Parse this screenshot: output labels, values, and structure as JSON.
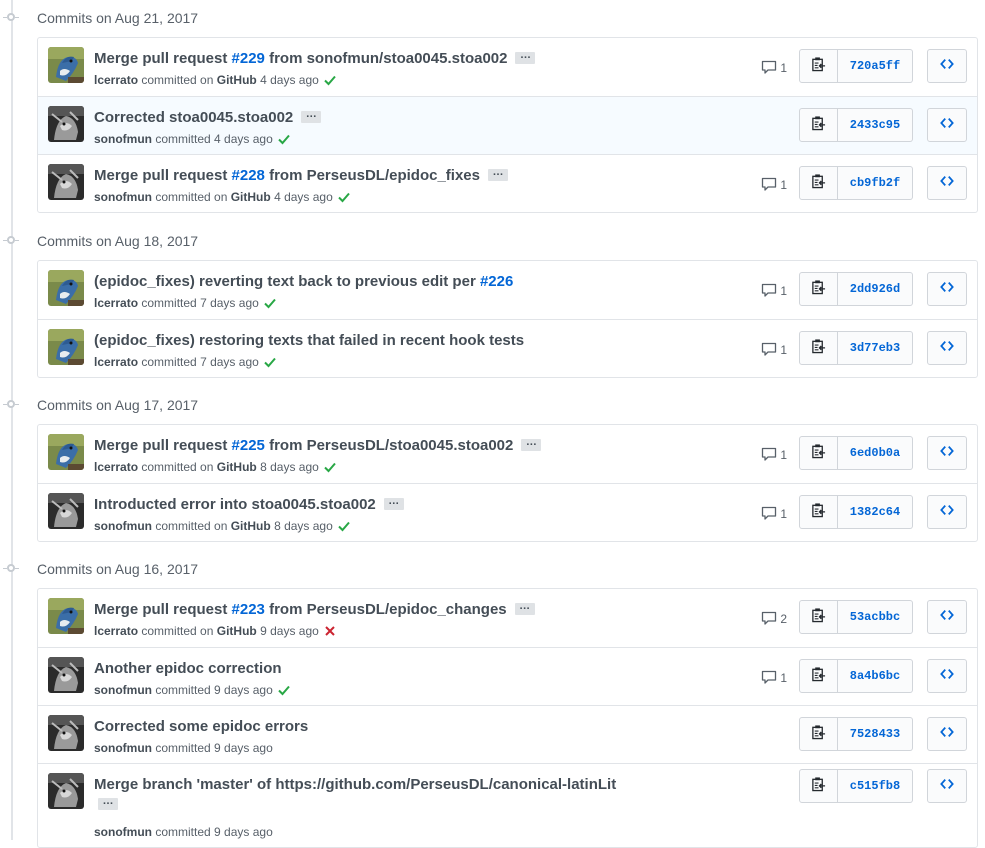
{
  "colors": {
    "link": "#0366d6",
    "success": "#28a745",
    "failure": "#cb2431"
  },
  "groups": [
    {
      "title": "Commits on Aug 21, 2017",
      "commits": [
        {
          "msg_pre": "Merge pull request ",
          "pr": "#229",
          "msg_post": " from sonofmun/stoa0045.stoa002",
          "ellipsis": "…",
          "author": "lcerrato",
          "verb": "committed on",
          "platform": "GitHub",
          "time": "4 days ago",
          "status": "success",
          "comments": "1",
          "sha": "720a5ff",
          "avatar": "bluejay"
        },
        {
          "msg_pre": "Corrected stoa0045.stoa002",
          "ellipsis": "…",
          "author": "sonofmun",
          "verb": "committed",
          "time": "4 days ago",
          "status": "success",
          "sha": "2433c95",
          "avatar": "bw"
        },
        {
          "msg_pre": "Merge pull request ",
          "pr": "#228",
          "msg_post": " from PerseusDL/epidoc_fixes",
          "ellipsis": "…",
          "author": "sonofmun",
          "verb": "committed on",
          "platform": "GitHub",
          "time": "4 days ago",
          "status": "success",
          "comments": "1",
          "sha": "cb9fb2f",
          "avatar": "bw"
        }
      ]
    },
    {
      "title": "Commits on Aug 18, 2017",
      "commits": [
        {
          "msg_pre": "(epidoc_fixes) reverting text back to previous edit per ",
          "pr": "#226",
          "author": "lcerrato",
          "verb": "committed",
          "time": "7 days ago",
          "status": "success",
          "comments": "1",
          "sha": "2dd926d",
          "avatar": "bluejay"
        },
        {
          "msg_pre": "(epidoc_fixes) restoring texts that failed in recent hook tests",
          "author": "lcerrato",
          "verb": "committed",
          "time": "7 days ago",
          "status": "success",
          "comments": "1",
          "sha": "3d77eb3",
          "avatar": "bluejay"
        }
      ]
    },
    {
      "title": "Commits on Aug 17, 2017",
      "commits": [
        {
          "msg_pre": "Merge pull request ",
          "pr": "#225",
          "msg_post": " from PerseusDL/stoa0045.stoa002",
          "ellipsis": "…",
          "author": "lcerrato",
          "verb": "committed on",
          "platform": "GitHub",
          "time": "8 days ago",
          "status": "success",
          "comments": "1",
          "sha": "6ed0b0a",
          "avatar": "bluejay"
        },
        {
          "msg_pre": "Introducted error into stoa0045.stoa002",
          "ellipsis": "…",
          "author": "sonofmun",
          "verb": "committed on",
          "platform": "GitHub",
          "time": "8 days ago",
          "status": "success",
          "comments": "1",
          "sha": "1382c64",
          "avatar": "bw"
        }
      ]
    },
    {
      "title": "Commits on Aug 16, 2017",
      "commits": [
        {
          "msg_pre": "Merge pull request ",
          "pr": "#223",
          "msg_post": " from PerseusDL/epidoc_changes",
          "ellipsis": "…",
          "author": "lcerrato",
          "verb": "committed on",
          "platform": "GitHub",
          "time": "9 days ago",
          "status": "failure",
          "comments": "2",
          "sha": "53acbbc",
          "avatar": "bluejay"
        },
        {
          "msg_pre": "Another epidoc correction",
          "author": "sonofmun",
          "verb": "committed",
          "time": "9 days ago",
          "status": "success",
          "comments": "1",
          "sha": "8a4b6bc",
          "avatar": "bw"
        },
        {
          "msg_pre": "Corrected some epidoc errors",
          "author": "sonofmun",
          "verb": "committed",
          "time": "9 days ago",
          "sha": "7528433",
          "avatar": "bw"
        },
        {
          "msg_pre": "Merge branch 'master' of https://github.com/PerseusDL/canonical-latinLit",
          "ellipsis": "…",
          "ellipsis_below": true,
          "author": "sonofmun",
          "verb": "committed",
          "time": "9 days ago",
          "sha": "c515fb8",
          "avatar": "bw"
        }
      ]
    }
  ]
}
